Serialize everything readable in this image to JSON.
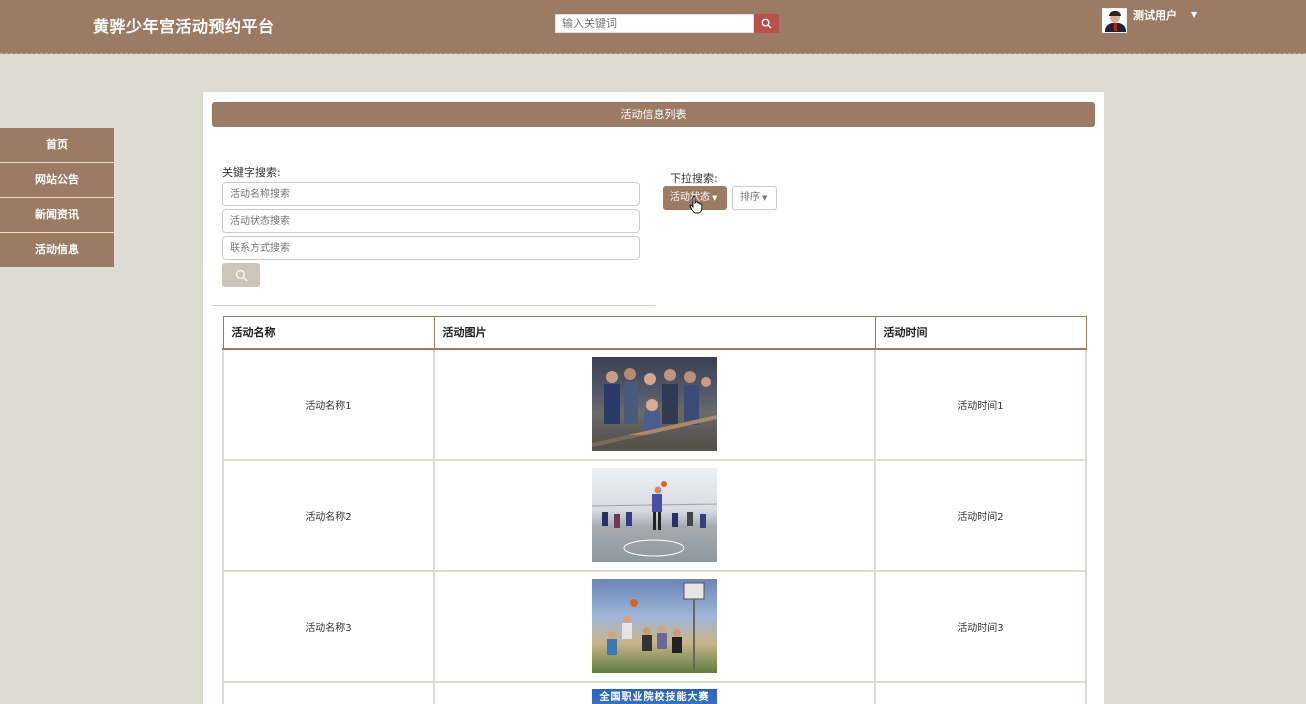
{
  "header": {
    "site_title": "黄骅少年宫活动预约平台",
    "search_placeholder": "输入关键词",
    "username": "测试用户"
  },
  "sidebar": {
    "items": [
      {
        "label": "首页"
      },
      {
        "label": "网站公告"
      },
      {
        "label": "新闻资讯"
      },
      {
        "label": "活动信息"
      }
    ]
  },
  "main": {
    "title": "活动信息列表",
    "keyword_search_label": "关键字搜索:",
    "name_placeholder": "活动名称搜索",
    "status_placeholder": "活动状态搜索",
    "contact_placeholder": "联系方式搜索",
    "dropdown_search_label": "下拉搜索:",
    "status_dropdown": "活动状态",
    "sort_dropdown": "排序"
  },
  "table": {
    "headers": [
      "活动名称",
      "活动图片",
      "活动时间"
    ],
    "rows": [
      {
        "name": "活动名称1",
        "time": "活动时间1"
      },
      {
        "name": "活动名称2",
        "time": "活动时间2"
      },
      {
        "name": "活动名称3",
        "time": "活动时间3"
      }
    ],
    "partial_image_text": "全国职业院校技能大赛"
  },
  "colors": {
    "brand": "#9b7b64",
    "search_button": "#b5524c",
    "background": "#dcdcd2"
  }
}
